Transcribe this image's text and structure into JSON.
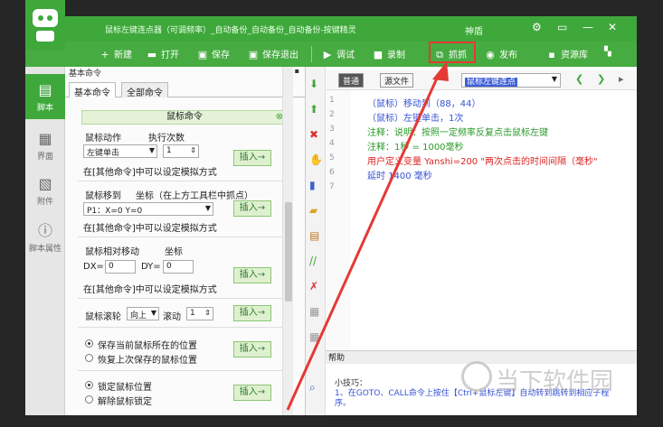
{
  "window": {
    "title": "鼠标左键连点器（可调频率）_自动备份_自动备份_自动备份-按键精灵",
    "god_label": "神盾",
    "controls": [
      "⚙",
      "▭",
      "—",
      "✕"
    ]
  },
  "toolbar": {
    "items": [
      {
        "icon": "plus-icon",
        "label": "新建"
      },
      {
        "icon": "folder-icon",
        "label": "打开"
      },
      {
        "icon": "save-icon",
        "label": "保存"
      },
      {
        "icon": "save-exit-icon",
        "label": "保存退出"
      },
      {
        "icon": "debug-icon",
        "label": "调试"
      },
      {
        "icon": "record-icon",
        "label": "录制"
      },
      {
        "icon": "capture-icon",
        "label": "抓抓"
      },
      {
        "icon": "publish-icon",
        "label": "发布"
      },
      {
        "icon": "resource-icon",
        "label": "资源库"
      }
    ]
  },
  "leftnav": {
    "items": [
      {
        "label": "脚本",
        "active": true
      },
      {
        "label": "界面",
        "active": false
      },
      {
        "label": "附件",
        "active": false
      },
      {
        "label": "脚本属性",
        "active": false
      }
    ]
  },
  "panel": {
    "header": "基本命令",
    "tabs": [
      "基本命令",
      "全部命令"
    ],
    "section_title": "鼠标命令",
    "action_label": "鼠标动作",
    "count_label": "执行次数",
    "action_value": "左键单击",
    "count_value": "1",
    "insert_label": "插入→",
    "other_cmd_hint": "在[其他命令]中可以设定模拟方式",
    "move_label": "鼠标移到",
    "coord_label": "坐标（在上方工具栏中抓点）",
    "point_value": "P1：X=0 Y=0",
    "relative_label": "鼠标相对移动",
    "rel_coord_label": "坐标",
    "dx_label": "DX=",
    "dx_value": "0",
    "dy_label": "DY=",
    "dy_value": "0",
    "wheel_label": "鼠标滚轮",
    "wheel_dir": "向上",
    "scroll_label": "滚动",
    "scroll_value": "1",
    "save_pos": "保存当前鼠标所在的位置",
    "restore_pos": "恢复上次保存的鼠标位置",
    "lock_pos": "锁定鼠标位置",
    "unlock_pos": "解除鼠标锁定"
  },
  "editor": {
    "mode_normal": "普通",
    "mode_source": "源文件",
    "search_value": "鼠标左键连点",
    "lines": [
      {
        "no": "1",
        "text": "（鼠标）移动到（88，44）",
        "color": "blue"
      },
      {
        "no": "2",
        "text": "（鼠标）左键单击，1次",
        "color": "blue"
      },
      {
        "no": "3",
        "text": "注释：说明：按照一定频率反复点击鼠标左键",
        "color": "green"
      },
      {
        "no": "4",
        "text": "注释：1秒 = 1000毫秒",
        "color": "green"
      },
      {
        "no": "5",
        "text": "用户定义变量 Yanshi=200 \"两次点击的时间间隔（毫秒\"",
        "color": "red"
      },
      {
        "no": "6",
        "text": "延时 1400 毫秒",
        "color": "blue"
      },
      {
        "no": "7",
        "text": "",
        "color": "blue"
      }
    ]
  },
  "help": {
    "header": "帮助",
    "tip_title": "小技巧：",
    "tip_text": "1、在GOTO、CALL命令上按住【Ctrl+鼠标左键】自动转到跳转到相应子程序。"
  },
  "watermark": {
    "text": "当下软件园"
  }
}
